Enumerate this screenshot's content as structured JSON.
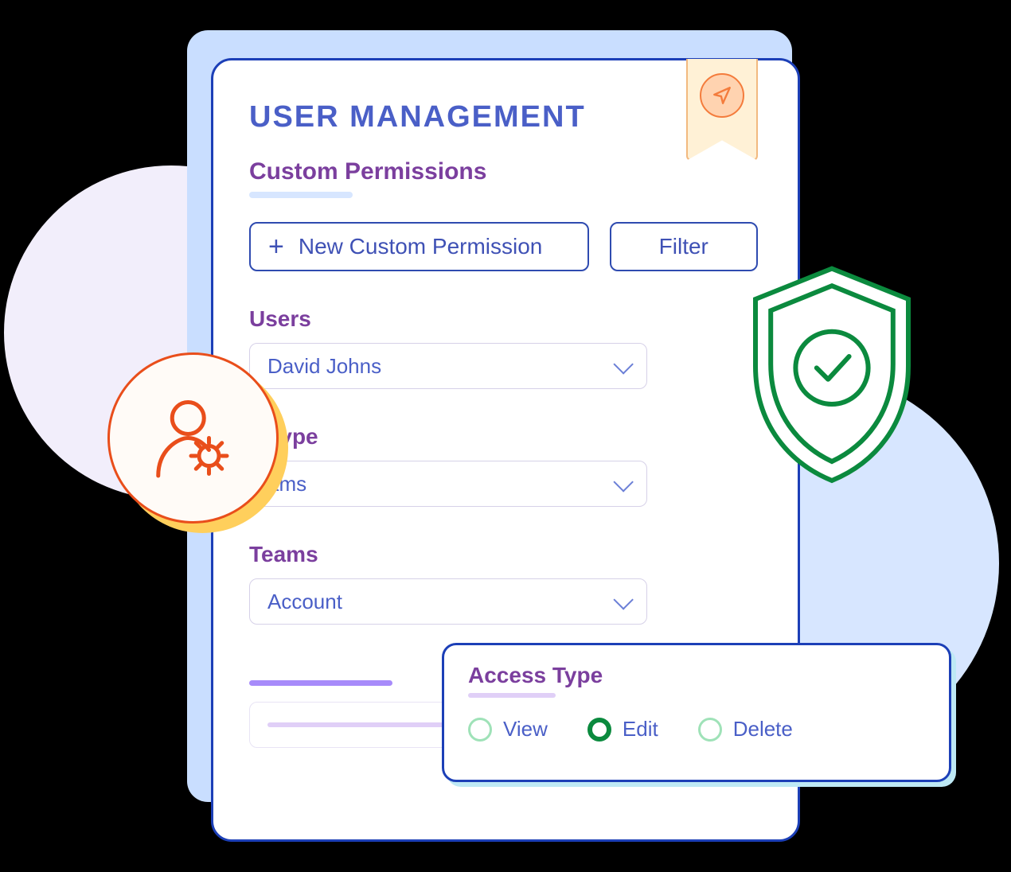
{
  "page": {
    "title": "USER MANAGEMENT"
  },
  "permissions": {
    "section_label": "Custom Permissions",
    "new_button": "New Custom Permission",
    "filter_button": "Filter"
  },
  "fields": {
    "users": {
      "label": "Users",
      "value": "David Johns"
    },
    "by_type": {
      "label": "By Type",
      "value": "Teams",
      "visible_label_fragment": "y Type",
      "visible_value_fragment": "ams"
    },
    "teams": {
      "label": "Teams",
      "value": "Account"
    }
  },
  "access": {
    "title": "Access Type",
    "options": [
      {
        "label": "View",
        "selected": false
      },
      {
        "label": "Edit",
        "selected": true
      },
      {
        "label": "Delete",
        "selected": false
      }
    ]
  },
  "colors": {
    "primary_blue": "#1C3FB7",
    "text_blue": "#4A5FC7",
    "purple": "#7B3F9E",
    "green": "#0B8A3E",
    "orange": "#E94E1B"
  }
}
